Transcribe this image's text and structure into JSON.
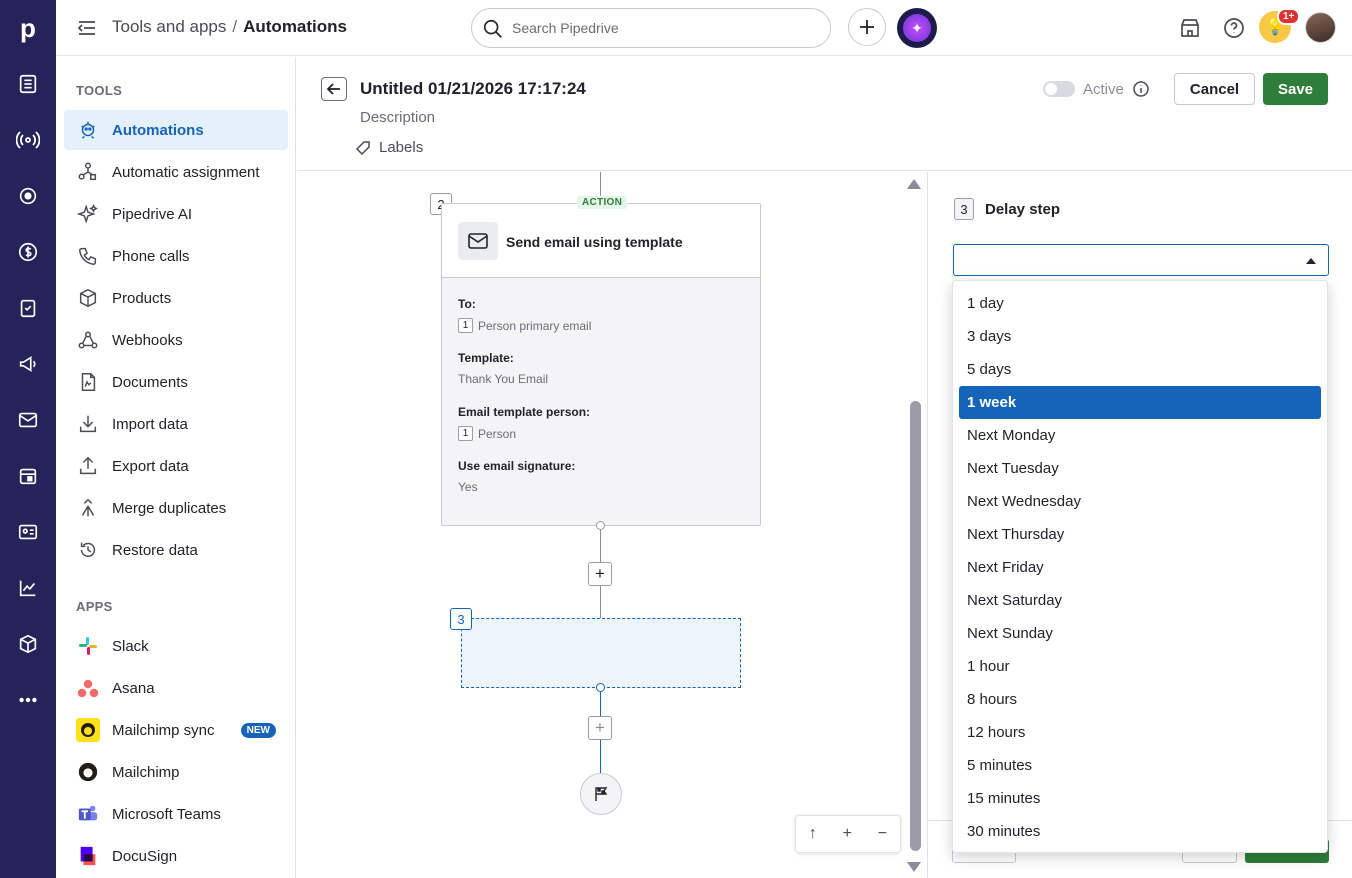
{
  "topbar": {
    "breadcrumb_parent": "Tools and apps",
    "breadcrumb_sep": "/",
    "breadcrumb_current": "Automations",
    "search_placeholder": "Search Pipedrive",
    "notification_badge": "1+"
  },
  "rail": {
    "logo": "p",
    "icons": [
      "leads-icon",
      "broadcast-icon",
      "target-icon",
      "dollar-icon",
      "tasks-icon",
      "megaphone-icon",
      "mail-icon",
      "calendar-icon",
      "contacts-icon",
      "chart-icon",
      "box-icon",
      "more-icon"
    ]
  },
  "sidebar": {
    "tools_heading": "TOOLS",
    "tools": [
      {
        "label": "Automations",
        "icon": "robot-icon",
        "active": true
      },
      {
        "label": "Automatic assignment",
        "icon": "assignment-icon"
      },
      {
        "label": "Pipedrive AI",
        "icon": "sparkle-icon"
      },
      {
        "label": "Phone calls",
        "icon": "phone-icon"
      },
      {
        "label": "Products",
        "icon": "box-icon"
      },
      {
        "label": "Webhooks",
        "icon": "webhook-icon"
      },
      {
        "label": "Documents",
        "icon": "document-icon"
      },
      {
        "label": "Import data",
        "icon": "import-icon"
      },
      {
        "label": "Export data",
        "icon": "export-icon"
      },
      {
        "label": "Merge duplicates",
        "icon": "merge-icon"
      },
      {
        "label": "Restore data",
        "icon": "restore-icon"
      }
    ],
    "apps_heading": "APPS",
    "apps": [
      {
        "label": "Slack",
        "icon": "slack-icon"
      },
      {
        "label": "Asana",
        "icon": "asana-icon"
      },
      {
        "label": "Mailchimp sync",
        "icon": "mailchimp-icon",
        "badge": "NEW"
      },
      {
        "label": "Mailchimp",
        "icon": "mailchimp-icon"
      },
      {
        "label": "Microsoft Teams",
        "icon": "teams-icon"
      },
      {
        "label": "DocuSign",
        "icon": "docusign-icon"
      }
    ]
  },
  "header": {
    "title": "Untitled 01/21/2026 17:17:24",
    "description": "Description",
    "labels": "Labels",
    "active_label": "Active",
    "cancel": "Cancel",
    "save": "Save"
  },
  "canvas": {
    "step2": {
      "number": "2",
      "tag": "ACTION",
      "title": "Send email using template",
      "fields": [
        {
          "label": "To:",
          "chip": "1",
          "value": "Person primary email"
        },
        {
          "label": "Template:",
          "chip": "",
          "value": "Thank You Email"
        },
        {
          "label": "Email template person:",
          "chip": "1",
          "value": "Person"
        },
        {
          "label": "Use email signature:",
          "chip": "",
          "value": "Yes"
        }
      ]
    },
    "step3_number": "3",
    "add": "+",
    "zoom": {
      "up": "↑",
      "plus": "+",
      "minus": "−"
    }
  },
  "panel": {
    "step_number": "3",
    "title": "Delay step",
    "select_value": ""
  },
  "dropdown": {
    "selected": "1 week",
    "options": [
      "1 day",
      "3 days",
      "5 days",
      "1 week",
      "Next Monday",
      "Next Tuesday",
      "Next Wednesday",
      "Next Thursday",
      "Next Friday",
      "Next Saturday",
      "Next Sunday",
      "1 hour",
      "8 hours",
      "12 hours",
      "5 minutes",
      "15 minutes",
      "30 minutes"
    ]
  },
  "colors": {
    "rail": "#26235b",
    "accent": "#1564b9",
    "save": "#2e7d3a"
  }
}
